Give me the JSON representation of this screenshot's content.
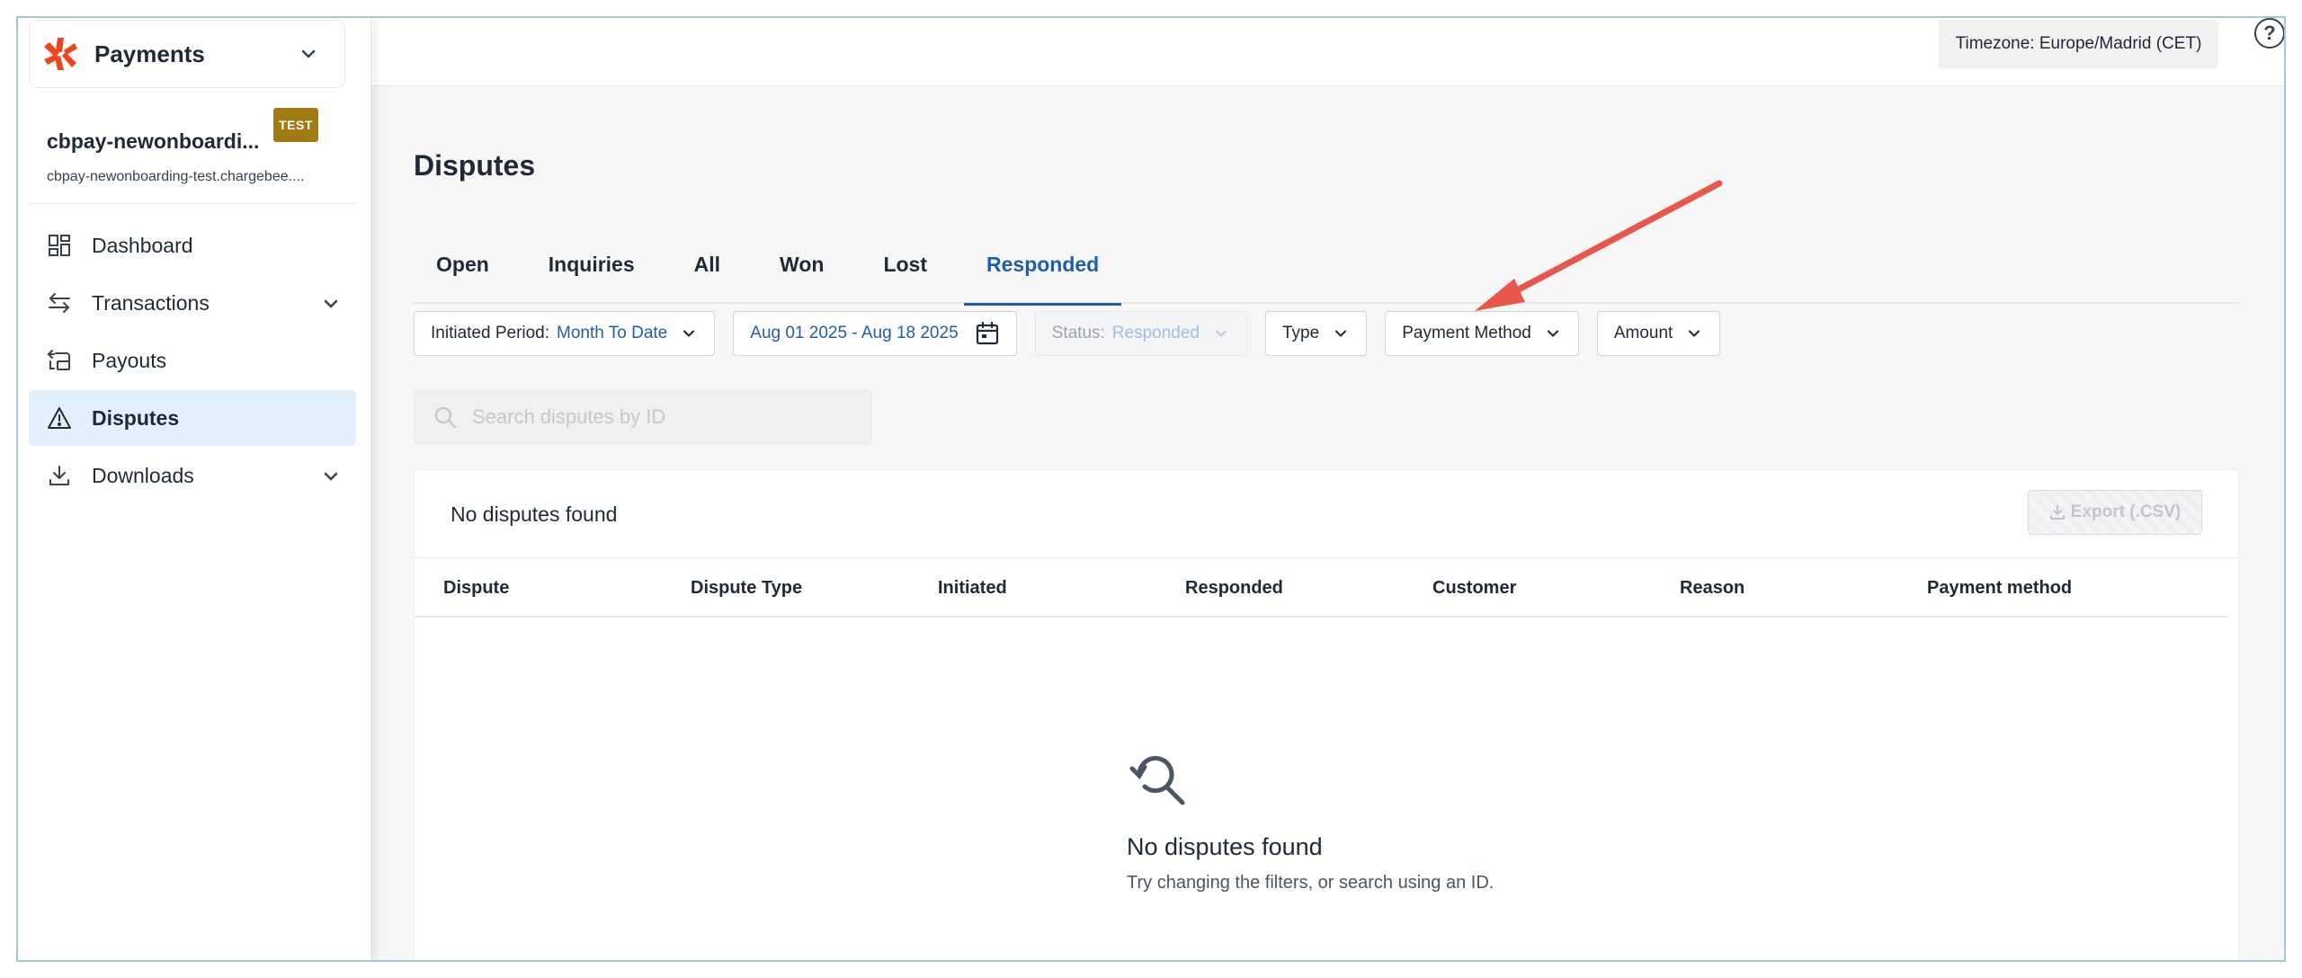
{
  "app": {
    "name": "Payments"
  },
  "site": {
    "name": "cbpay-newonboardi...",
    "badge": "TEST",
    "domain": "cbpay-newonboarding-test.chargebee...."
  },
  "sidebar": {
    "items": [
      {
        "label": "Dashboard",
        "icon": "dashboard-icon"
      },
      {
        "label": "Transactions",
        "icon": "transfer-arrows-icon"
      },
      {
        "label": "Payouts",
        "icon": "payout-icon"
      },
      {
        "label": "Disputes",
        "icon": "warning-triangle-icon",
        "active": true
      },
      {
        "label": "Downloads",
        "icon": "download-icon"
      }
    ]
  },
  "topbar": {
    "timezone": "Timezone: Europe/Madrid (CET)",
    "help": "?"
  },
  "page": {
    "title": "Disputes"
  },
  "tabs": [
    "Open",
    "Inquiries",
    "All",
    "Won",
    "Lost",
    "Responded"
  ],
  "active_tab": "Responded",
  "filters": {
    "period_label": "Initiated Period:",
    "period_value": "Month To Date",
    "date_range": "Aug 01 2025 - Aug 18 2025",
    "status_label": "Status:",
    "status_value": "Responded",
    "type": "Type",
    "payment_method": "Payment Method",
    "amount": "Amount"
  },
  "search": {
    "placeholder": "Search disputes by ID"
  },
  "table": {
    "title": "No disputes found",
    "export_label": "Export (.CSV)",
    "columns": [
      "Dispute",
      "Dispute Type",
      "Initiated",
      "Responded",
      "Customer",
      "Reason",
      "Payment method"
    ]
  },
  "empty_state": {
    "title": "No disputes found",
    "subtitle": "Try changing the filters, or search using an ID."
  },
  "colors": {
    "accent": "#1f5fa8",
    "brand": "#f0441c",
    "badge": "#a07a13",
    "annotation_arrow": "#e8574a"
  }
}
